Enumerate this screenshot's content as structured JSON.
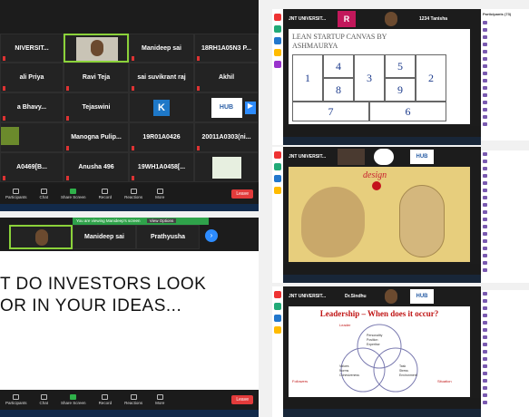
{
  "panel1": {
    "tiles": [
      {
        "label": "NIVERSIT..."
      },
      {
        "label": "Manideep sai"
      },
      {
        "label": "18RH1A05N3 P..."
      },
      {
        "label": "ali Priya"
      },
      {
        "label": "Ravi Teja"
      },
      {
        "label": "sai suvikrant raj"
      },
      {
        "label": "Akhil"
      },
      {
        "label": "a Bhavy..."
      },
      {
        "label": "Tejaswini"
      },
      {
        "label": "Manogna Pulip..."
      },
      {
        "label": "19R01A0426"
      },
      {
        "label": "20011A0303(ni..."
      },
      {
        "label": "A0469[B..."
      },
      {
        "label": "Anusha 496"
      },
      {
        "label": "19WH1A0458[..."
      }
    ],
    "k_tile": "K",
    "hub_logo": "HUB",
    "toolbar": [
      "Participants",
      "Chat",
      "Share Screen",
      "Record",
      "Reactions",
      "More"
    ],
    "leave": "Leave"
  },
  "panel2": {
    "notice": "You are viewing Manideep's screen",
    "view_options": "View Options",
    "tile2": "Manideep sai",
    "tile3": "Prathyusha",
    "heading_line1": "T DO INVESTORS LOOK",
    "heading_line2": "OR IN YOUR IDEAS...",
    "toolbar": [
      "Participants",
      "Chat",
      "Share Screen",
      "Record",
      "Reactions",
      "More"
    ],
    "leave": "Leave"
  },
  "panel3": {
    "title": "JNT UNIVERSIT...",
    "tile_r": "R",
    "tile_name": "1234 Tanisha",
    "slide_title": "LEAN STARTUP CANVAS BY",
    "slide_sub": "ASHMAURYA",
    "numbers": [
      "1",
      "4",
      "3",
      "2",
      "5",
      "8",
      "9",
      "7",
      "6"
    ],
    "participants_header": "Participants (73)"
  },
  "panel4": {
    "title": "JNT UNIVERSIT...",
    "hub": "HUB",
    "design_word": "design"
  },
  "panel5": {
    "title": "JNT UNIVERSIT...",
    "tile_name": "Dr.Sindhu",
    "hub": "HUB",
    "slide_title": "Leadership – When does it occur?",
    "venn": {
      "leader": "Leader",
      "followers": "Followers",
      "situation": "Situation",
      "center_top": "Personality\nPosition\nExpertise",
      "center_left": "Values\nNorms\nCohesiveness",
      "center_right": "Task\nStress\nEnvironment"
    }
  }
}
